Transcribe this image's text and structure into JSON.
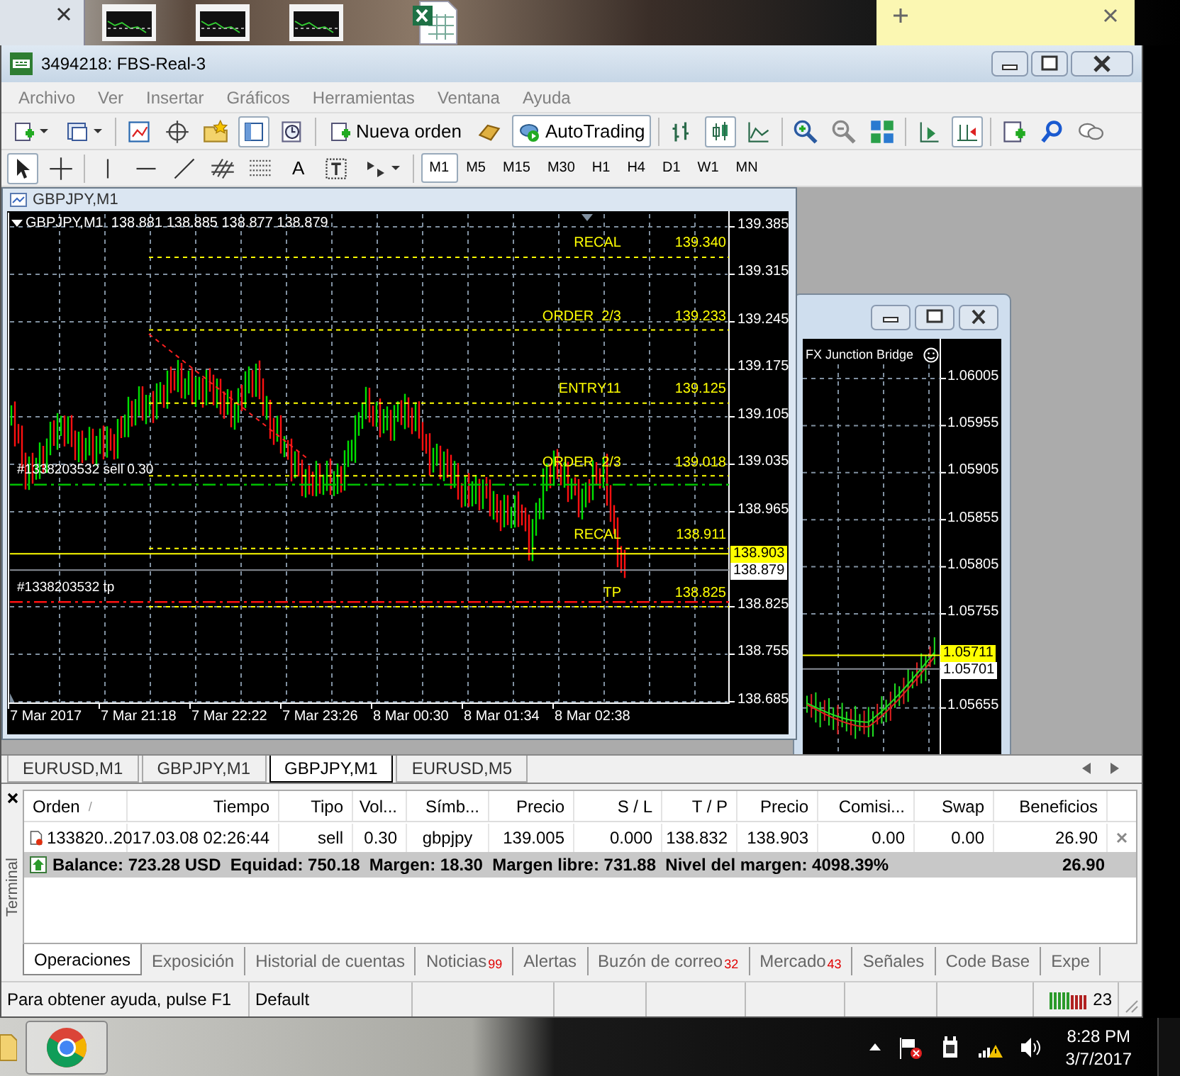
{
  "window": {
    "title": "3494218: FBS-Real-3"
  },
  "menu": [
    "Archivo",
    "Ver",
    "Insertar",
    "Gráficos",
    "Herramientas",
    "Ventana",
    "Ayuda"
  ],
  "toolbar": {
    "new_order": "Nueva orden",
    "autotrading": {
      "label": "AutoTrading",
      "pressed": true
    }
  },
  "line_studies": {
    "text_tool": "A"
  },
  "timeframes": [
    {
      "label": "M1",
      "selected": true
    },
    {
      "label": "M5",
      "selected": false
    },
    {
      "label": "M15",
      "selected": false
    },
    {
      "label": "M30",
      "selected": false
    },
    {
      "label": "H1",
      "selected": false
    },
    {
      "label": "H4",
      "selected": false
    },
    {
      "label": "D1",
      "selected": false
    },
    {
      "label": "W1",
      "selected": false
    },
    {
      "label": "MN",
      "selected": false
    }
  ],
  "chart_window": {
    "title": "GBPJPY,M1",
    "header": "GBPJPY,M1  138.881 138.885 138.877 138.879",
    "price_axis": [
      "139.385",
      "139.315",
      "139.245",
      "139.175",
      "139.105",
      "139.035",
      "138.965",
      "138.825",
      "138.755",
      "138.685"
    ],
    "time_axis": [
      "7 Mar 2017",
      "7 Mar 21:18",
      "7 Mar 22:22",
      "7 Mar 23:26",
      "8 Mar 00:30",
      "8 Mar 01:34",
      "8 Mar 02:38"
    ],
    "levels": [
      {
        "label": "RECAL",
        "price": "139.340"
      },
      {
        "label": "ORDER  2/3",
        "price": "139.233"
      },
      {
        "label": "ENTRY11",
        "price": "139.125"
      },
      {
        "label": "ORDER  2/3",
        "price": "139.018"
      },
      {
        "label": "RECAL",
        "price": "138.911"
      },
      {
        "label": "TP",
        "price": "138.825"
      }
    ],
    "orders": [
      {
        "kind": "entry",
        "label": "#1338203532 sell 0.30"
      },
      {
        "kind": "take_profit",
        "label": "#1338203532 tp"
      }
    ],
    "bid_tag": "138.903",
    "last_tag": "138.879"
  },
  "background_chart": {
    "header": "FX Junction Bridge",
    "price_axis": [
      "1.06005",
      "1.05955",
      "1.05905",
      "1.05855",
      "1.05805",
      "1.05755",
      "1.05655"
    ],
    "ask_tag": "1.05711",
    "bid_tag": "1.05701"
  },
  "chart_tabs": [
    {
      "label": "EURUSD,M1",
      "selected": false
    },
    {
      "label": "GBPJPY,M1",
      "selected": false
    },
    {
      "label": "GBPJPY,M1",
      "selected": true
    },
    {
      "label": "EURUSD,M5",
      "selected": false
    }
  ],
  "terminal": {
    "side_label": "Terminal",
    "columns": [
      {
        "label": "Orden",
        "sort": "/"
      },
      {
        "label": "Tiempo"
      },
      {
        "label": "Tipo"
      },
      {
        "label": "Vol..."
      },
      {
        "label": "Símb..."
      },
      {
        "label": "Precio"
      },
      {
        "label": "S / L"
      },
      {
        "label": "T / P"
      },
      {
        "label": "Precio"
      },
      {
        "label": "Comisi..."
      },
      {
        "label": "Swap"
      },
      {
        "label": "Beneficios"
      }
    ],
    "rows": [
      [
        "133820...",
        "2017.03.08 02:26:44",
        "sell",
        "0.30",
        "gbpjpy",
        "139.005",
        "0.000",
        "138.832",
        "138.903",
        "0.00",
        "0.00",
        "26.90"
      ]
    ],
    "summary": {
      "text": "Balance: 723.28 USD  Equidad: 750.18  Margen: 18.30  Margen libre: 731.88  Nivel del margen: 4098.39%",
      "profit": "26.90"
    },
    "tabs": [
      {
        "label": "Operaciones",
        "selected": true
      },
      {
        "label": "Exposición",
        "selected": false
      },
      {
        "label": "Historial de cuentas",
        "selected": false
      },
      {
        "label": "Noticias",
        "badge": "99",
        "selected": false
      },
      {
        "label": "Alertas",
        "selected": false
      },
      {
        "label": "Buzón de correo",
        "badge": "32",
        "selected": false
      },
      {
        "label": "Mercado",
        "badge": "43",
        "selected": false
      },
      {
        "label": "Señales",
        "selected": false
      },
      {
        "label": "Code Base",
        "selected": false
      },
      {
        "label": "Expe",
        "selected": false
      }
    ]
  },
  "status_bar": {
    "help": "Para obtener ayuda, pulse F1",
    "profile": "Default",
    "connection": "23"
  },
  "taskbar": {
    "time": "8:28 PM",
    "date": "3/7/2017"
  }
}
